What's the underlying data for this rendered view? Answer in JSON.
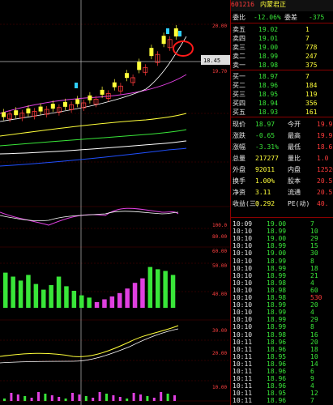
{
  "stock": {
    "code": "601216",
    "name": "内蒙君正"
  },
  "chart": {
    "candles": [
      [
        0,
        10
      ],
      [
        1,
        8
      ],
      [
        0,
        12
      ],
      [
        1,
        9
      ],
      [
        0,
        14
      ],
      [
        1,
        11
      ],
      [
        0,
        16
      ],
      [
        1,
        13
      ],
      [
        0,
        19
      ],
      [
        1,
        15
      ],
      [
        0,
        21
      ],
      [
        1,
        18
      ],
      [
        0,
        24
      ],
      [
        1,
        20
      ],
      [
        0,
        28
      ],
      [
        1,
        24
      ],
      [
        0,
        34
      ],
      [
        1,
        30
      ],
      [
        0,
        42
      ],
      [
        1,
        38
      ],
      [
        0,
        52
      ],
      [
        1,
        47
      ],
      [
        0,
        64
      ],
      [
        1,
        58
      ],
      [
        0,
        79
      ],
      [
        1,
        72
      ],
      [
        0,
        92
      ],
      [
        1,
        88
      ],
      [
        0,
        100
      ]
    ],
    "price_tag": "18.45"
  },
  "quote": {
    "diff": {
      "label": "委比",
      "value": "-12.06%",
      "label2": "委差",
      "value2": "-375"
    },
    "sell": [
      {
        "label": "卖五",
        "price": "19.02",
        "vol": "1"
      },
      {
        "label": "卖四",
        "price": "19.01",
        "vol": "7"
      },
      {
        "label": "卖三",
        "price": "19.00",
        "vol": "778"
      },
      {
        "label": "卖二",
        "price": "18.99",
        "vol": "247"
      },
      {
        "label": "卖一",
        "price": "18.98",
        "vol": "375"
      }
    ],
    "buy": [
      {
        "label": "买一",
        "price": "18.97",
        "vol": "7"
      },
      {
        "label": "买二",
        "price": "18.96",
        "vol": "184"
      },
      {
        "label": "买三",
        "price": "18.95",
        "vol": "119"
      },
      {
        "label": "买四",
        "price": "18.94",
        "vol": "356"
      },
      {
        "label": "买五",
        "price": "18.93",
        "vol": "161"
      }
    ],
    "stats": [
      {
        "l1": "现价",
        "v1": "18.97",
        "l2": "今开",
        "v2": "19.9"
      },
      {
        "l1": "涨跌",
        "v1": "-0.65",
        "l2": "最高",
        "v2": "19.9"
      },
      {
        "l1": "涨幅",
        "v1": "-3.31%",
        "l2": "最低",
        "v2": "18.6"
      },
      {
        "l1": "总量",
        "v1": "217277",
        "l2": "量比",
        "v2": "1.0"
      },
      {
        "l1": "外盘",
        "v1": "92011",
        "l2": "内盘",
        "v2": "12526"
      },
      {
        "l1": "换手",
        "v1": "1.00%",
        "l2": "股本",
        "v2": "20.5"
      },
      {
        "l1": "净资",
        "v1": "3.11",
        "l2": "流通",
        "v2": "20.5"
      },
      {
        "l1": "收益(三)",
        "v1": "0.292",
        "l2": "PE(动)",
        "v2": "40."
      }
    ],
    "ticks": [
      {
        "t": "10:09",
        "p": "19.00",
        "v": "7"
      },
      {
        "t": "10:10",
        "p": "18.99",
        "v": "10"
      },
      {
        "t": "10:10",
        "p": "19.00",
        "v": "29"
      },
      {
        "t": "10:10",
        "p": "18.99",
        "v": "15"
      },
      {
        "t": "10:10",
        "p": "19.00",
        "v": "30"
      },
      {
        "t": "10:10",
        "p": "18.99",
        "v": "8"
      },
      {
        "t": "10:10",
        "p": "18.99",
        "v": "18"
      },
      {
        "t": "10:10",
        "p": "18.99",
        "v": "21"
      },
      {
        "t": "10:10",
        "p": "18.98",
        "v": "4"
      },
      {
        "t": "10:10",
        "p": "18.98",
        "v": "60"
      },
      {
        "t": "10:10",
        "p": "18.98",
        "v": "530"
      },
      {
        "t": "10:10",
        "p": "18.99",
        "v": "20"
      },
      {
        "t": "10:10",
        "p": "18.99",
        "v": "4"
      },
      {
        "t": "10:10",
        "p": "18.99",
        "v": "29"
      },
      {
        "t": "10:10",
        "p": "18.99",
        "v": "8"
      },
      {
        "t": "10:10",
        "p": "18.98",
        "v": "16"
      },
      {
        "t": "10:11",
        "p": "18.96",
        "v": "20"
      },
      {
        "t": "10:11",
        "p": "18.96",
        "v": "18"
      },
      {
        "t": "10:11",
        "p": "18.95",
        "v": "10"
      },
      {
        "t": "10:11",
        "p": "18.96",
        "v": "14"
      },
      {
        "t": "10:11",
        "p": "18.96",
        "v": "6"
      },
      {
        "t": "10:11",
        "p": "18.96",
        "v": "9"
      },
      {
        "t": "10:11",
        "p": "18.96",
        "v": "4"
      },
      {
        "t": "10:11",
        "p": "18.95",
        "v": "12"
      },
      {
        "t": "10:11",
        "p": "18.96",
        "v": "7"
      }
    ]
  },
  "axis": {
    "a1": "20.00",
    "a2": "19.70",
    "a3": "100.0",
    "a4": "80.00",
    "a5": "60.00",
    "a6": "50.00",
    "a7": "40.00",
    "a8": "30.00",
    "a9": "20.00",
    "a10": "10.00"
  }
}
